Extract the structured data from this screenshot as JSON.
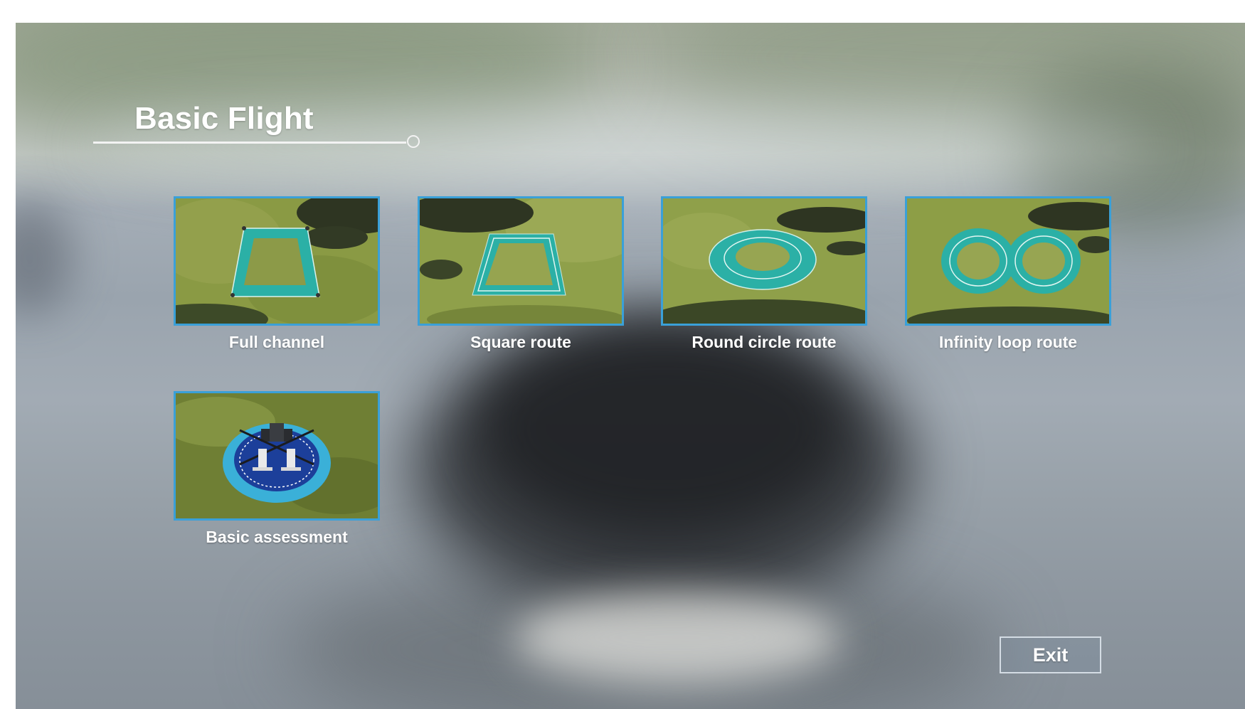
{
  "header": {
    "title": "Basic Flight"
  },
  "courses": [
    {
      "label": "Full channel",
      "icon": "full-channel-track"
    },
    {
      "label": "Square route",
      "icon": "square-route-track"
    },
    {
      "label": "Round circle route",
      "icon": "round-circle-track"
    },
    {
      "label": "Infinity loop route",
      "icon": "infinity-loop-track"
    },
    {
      "label": "Basic assessment",
      "icon": "landing-pad-drone"
    }
  ],
  "footer": {
    "exit_label": "Exit"
  },
  "colors": {
    "accent_border": "#3aa0d8",
    "track": "#2aa8a0",
    "text": "#ffffff"
  }
}
